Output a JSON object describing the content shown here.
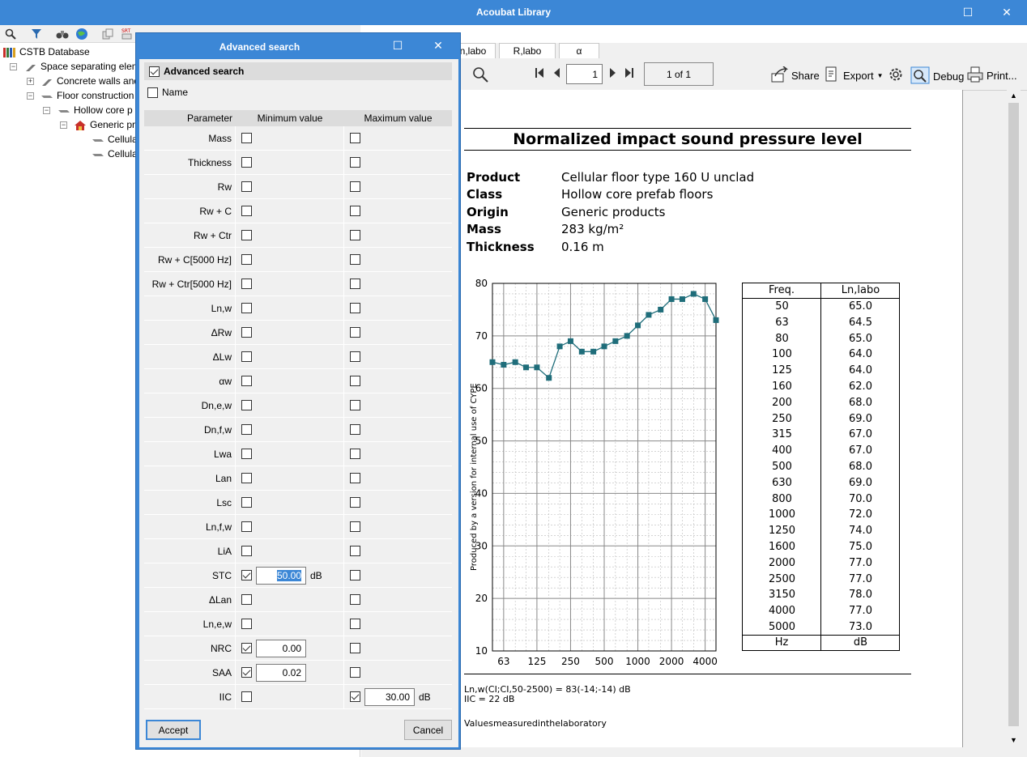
{
  "app": {
    "title": "Acoubat Library",
    "maximize_icon": "maximize-icon",
    "close_icon": "close-icon"
  },
  "tree": {
    "root": "CSTB Database",
    "n1": "Space separating elem",
    "n2": "Concrete walls and",
    "n3": "Floor construction",
    "n4": "Hollow core p",
    "n5": "Generic pr",
    "n6": "Cellula",
    "n7": "Cellula"
  },
  "viewer": {
    "tabs": [
      "n,labo",
      "R,labo",
      "α"
    ],
    "page_value": "1",
    "page_count": "1 of 1",
    "share_label": "Share",
    "export_label": "Export",
    "debug_label": "Debug",
    "print_label": "Print..."
  },
  "report": {
    "title": "Normalized impact sound pressure level",
    "props": [
      {
        "k": "Product",
        "v": "Cellular floor type 160 U unclad"
      },
      {
        "k": "Class",
        "v": "Hollow core prefab floors"
      },
      {
        "k": "Origin",
        "v": "Generic products"
      },
      {
        "k": "Mass",
        "v": "283 kg/m²"
      },
      {
        "k": "Thickness",
        "v": "0.16 m"
      }
    ],
    "watermark": "Produced by a version for internal use of CYPE",
    "footer1": "Ln,w(CI;CI,50-2500) = 83(-14;-14) dB",
    "footer2": "IIC = 22 dB",
    "footer3": "Valuesmeasuredinthelaboratory",
    "table_head": [
      "Freq.",
      "Ln,labo"
    ],
    "table_foot": [
      "Hz",
      "dB"
    ],
    "table_rows": [
      [
        "50",
        "65.0"
      ],
      [
        "63",
        "64.5"
      ],
      [
        "80",
        "65.0"
      ],
      [
        "100",
        "64.0"
      ],
      [
        "125",
        "64.0"
      ],
      [
        "160",
        "62.0"
      ],
      [
        "200",
        "68.0"
      ],
      [
        "250",
        "69.0"
      ],
      [
        "315",
        "67.0"
      ],
      [
        "400",
        "67.0"
      ],
      [
        "500",
        "68.0"
      ],
      [
        "630",
        "69.0"
      ],
      [
        "800",
        "70.0"
      ],
      [
        "1000",
        "72.0"
      ],
      [
        "1250",
        "74.0"
      ],
      [
        "1600",
        "75.0"
      ],
      [
        "2000",
        "77.0"
      ],
      [
        "2500",
        "77.0"
      ],
      [
        "3150",
        "78.0"
      ],
      [
        "4000",
        "77.0"
      ],
      [
        "5000",
        "73.0"
      ]
    ]
  },
  "chart_data": {
    "type": "line",
    "x": [
      50,
      63,
      80,
      100,
      125,
      160,
      200,
      250,
      315,
      400,
      500,
      630,
      800,
      1000,
      1250,
      1600,
      2000,
      2500,
      3150,
      4000,
      5000
    ],
    "series": [
      {
        "values": [
          65.0,
          64.5,
          65.0,
          64.0,
          64.0,
          62.0,
          68.0,
          69.0,
          67.0,
          67.0,
          68.0,
          69.0,
          70.0,
          72.0,
          74.0,
          75.0,
          77.0,
          77.0,
          78.0,
          77.0,
          73.0
        ]
      }
    ],
    "xticks": [
      "63",
      "125",
      "250",
      "500",
      "1000",
      "2000",
      "4000"
    ],
    "yticks": [
      "10",
      "20",
      "30",
      "40",
      "50",
      "60",
      "70",
      "80"
    ],
    "ylim": [
      10,
      80
    ],
    "xscale": "log",
    "grid": true,
    "color": "#1f6d7a"
  },
  "dialog": {
    "title": "Advanced search",
    "adv_label": "Advanced search",
    "name_label": "Name",
    "col_param": "Parameter",
    "col_min": "Minimum value",
    "col_max": "Maximum value",
    "accept": "Accept",
    "cancel": "Cancel",
    "rows": [
      {
        "p": "Mass",
        "minc": false,
        "maxc": false
      },
      {
        "p": "Thickness",
        "minc": false,
        "maxc": false
      },
      {
        "p": "Rw",
        "minc": false,
        "maxc": false
      },
      {
        "p": "Rw + C",
        "minc": false,
        "maxc": false
      },
      {
        "p": "Rw + Ctr",
        "minc": false,
        "maxc": false
      },
      {
        "p": "Rw + C[5000 Hz]",
        "minc": false,
        "maxc": false
      },
      {
        "p": "Rw + Ctr[5000 Hz]",
        "minc": false,
        "maxc": false
      },
      {
        "p": "Ln,w",
        "minc": false,
        "maxc": false
      },
      {
        "p": "ΔRw",
        "minc": false,
        "maxc": false
      },
      {
        "p": "ΔLw",
        "minc": false,
        "maxc": false
      },
      {
        "p": "αw",
        "minc": false,
        "maxc": false
      },
      {
        "p": "Dn,e,w",
        "minc": false,
        "maxc": false
      },
      {
        "p": "Dn,f,w",
        "minc": false,
        "maxc": false
      },
      {
        "p": "Lwa",
        "minc": false,
        "maxc": false
      },
      {
        "p": "Lan",
        "minc": false,
        "maxc": false
      },
      {
        "p": "Lsc",
        "minc": false,
        "maxc": false
      },
      {
        "p": "Ln,f,w",
        "minc": false,
        "maxc": false
      },
      {
        "p": "LiA",
        "minc": false,
        "maxc": false
      },
      {
        "p": "STC",
        "minc": true,
        "minv": "50.00",
        "minu": "dB",
        "sel": true,
        "maxc": false
      },
      {
        "p": "ΔLan",
        "minc": false,
        "maxc": false
      },
      {
        "p": "Ln,e,w",
        "minc": false,
        "maxc": false
      },
      {
        "p": "NRC",
        "minc": true,
        "minv": "0.00",
        "maxc": false
      },
      {
        "p": "SAA",
        "minc": true,
        "minv": "0.02",
        "maxc": false
      },
      {
        "p": "IIC",
        "minc": false,
        "maxc": true,
        "maxv": "30.00",
        "maxu": "dB"
      }
    ]
  }
}
